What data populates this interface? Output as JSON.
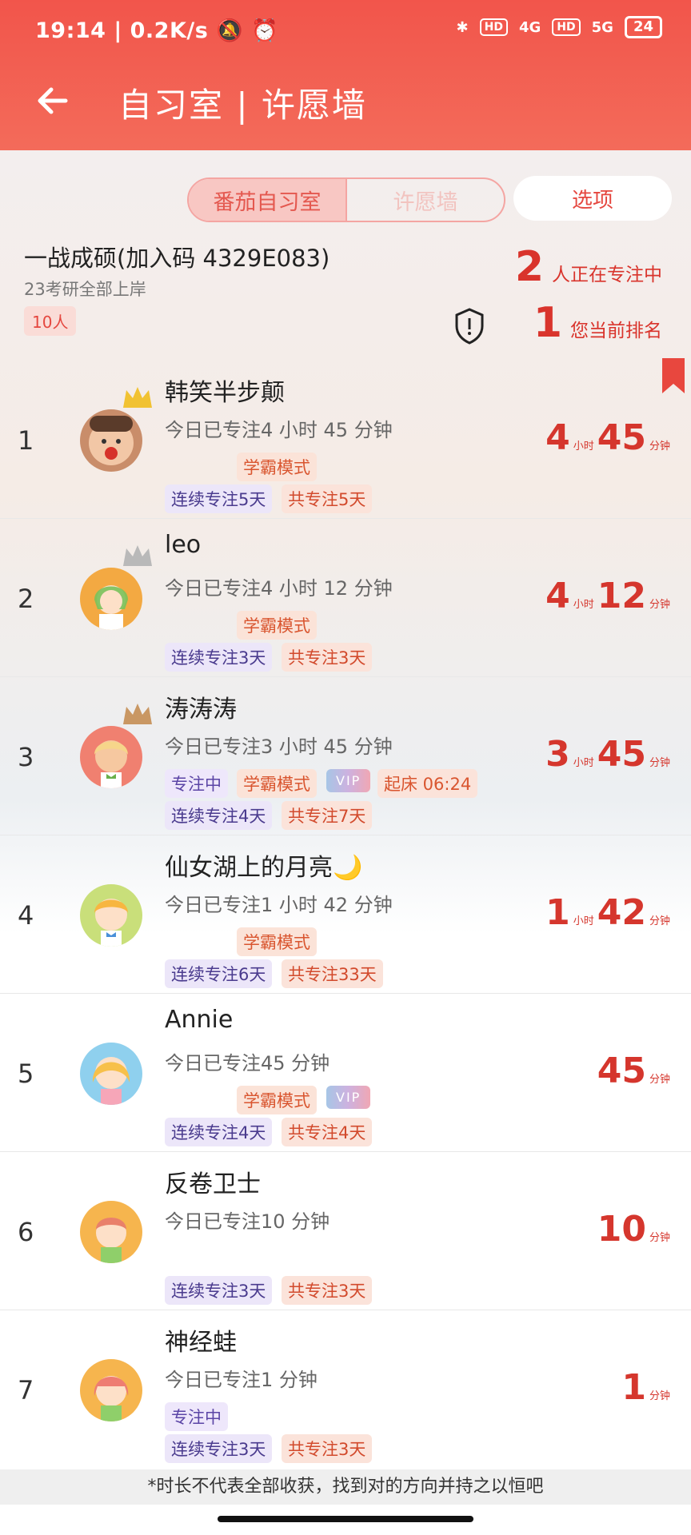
{
  "status_bar": {
    "time": "19:14",
    "speed": "0.2K/s",
    "hd": "HD",
    "net4g": "4G",
    "net5g": "5G",
    "battery": "24"
  },
  "header": {
    "title": "自习室 | 许愿墙"
  },
  "tabs": [
    {
      "label": "番茄自习室"
    },
    {
      "label": "许愿墙"
    }
  ],
  "options_label": "选项",
  "group": {
    "name": "一战成硕(加入码 4329E083)",
    "subtitle": "23考研全部上岸",
    "members": "10人"
  },
  "stats": {
    "focusing_count": "2",
    "focusing_label": "人正在专注中",
    "my_rank": "1",
    "my_rank_label": "您当前排名"
  },
  "rows": [
    {
      "rank": "1",
      "name": "韩笑半步颠",
      "desc": "今日已专注4 小时 45 分钟",
      "mode": "学霸模式",
      "streak": "连续专注5天",
      "total": "共专注5天",
      "h": "4",
      "h_unit": "小时",
      "m": "45",
      "m_unit": "分钟"
    },
    {
      "rank": "2",
      "name": "leo",
      "desc": "今日已专注4 小时 12 分钟",
      "mode": "学霸模式",
      "streak": "连续专注3天",
      "total": "共专注3天",
      "h": "4",
      "h_unit": "小时",
      "m": "12",
      "m_unit": "分钟"
    },
    {
      "rank": "3",
      "name": "涛涛涛",
      "desc": "今日已专注3 小时 45 分钟",
      "status": "专注中",
      "mode": "学霸模式",
      "vip": "VIP",
      "wake": "起床 06:24",
      "streak": "连续专注4天",
      "total": "共专注7天",
      "h": "3",
      "h_unit": "小时",
      "m": "45",
      "m_unit": "分钟"
    },
    {
      "rank": "4",
      "name": "仙女湖上的月亮🌙",
      "desc": "今日已专注1 小时 42 分钟",
      "mode": "学霸模式",
      "streak": "连续专注6天",
      "total": "共专注33天",
      "h": "1",
      "h_unit": "小时",
      "m": "42",
      "m_unit": "分钟"
    },
    {
      "rank": "5",
      "name": "Annie",
      "desc": "今日已专注45 分钟",
      "mode": "学霸模式",
      "vip": "VIP",
      "streak": "连续专注4天",
      "total": "共专注4天",
      "m": "45",
      "m_unit": "分钟"
    },
    {
      "rank": "6",
      "name": "反卷卫士",
      "desc": "今日已专注10 分钟",
      "streak": "连续专注3天",
      "total": "共专注3天",
      "m": "10",
      "m_unit": "分钟"
    },
    {
      "rank": "7",
      "name": "神经蛙",
      "desc": "今日已专注1 分钟",
      "status": "专注中",
      "streak": "连续专注3天",
      "total": "共专注3天",
      "m": "1",
      "m_unit": "分钟"
    }
  ],
  "footer": "*时长不代表全部收获，找到对的方向并持之以恒吧"
}
